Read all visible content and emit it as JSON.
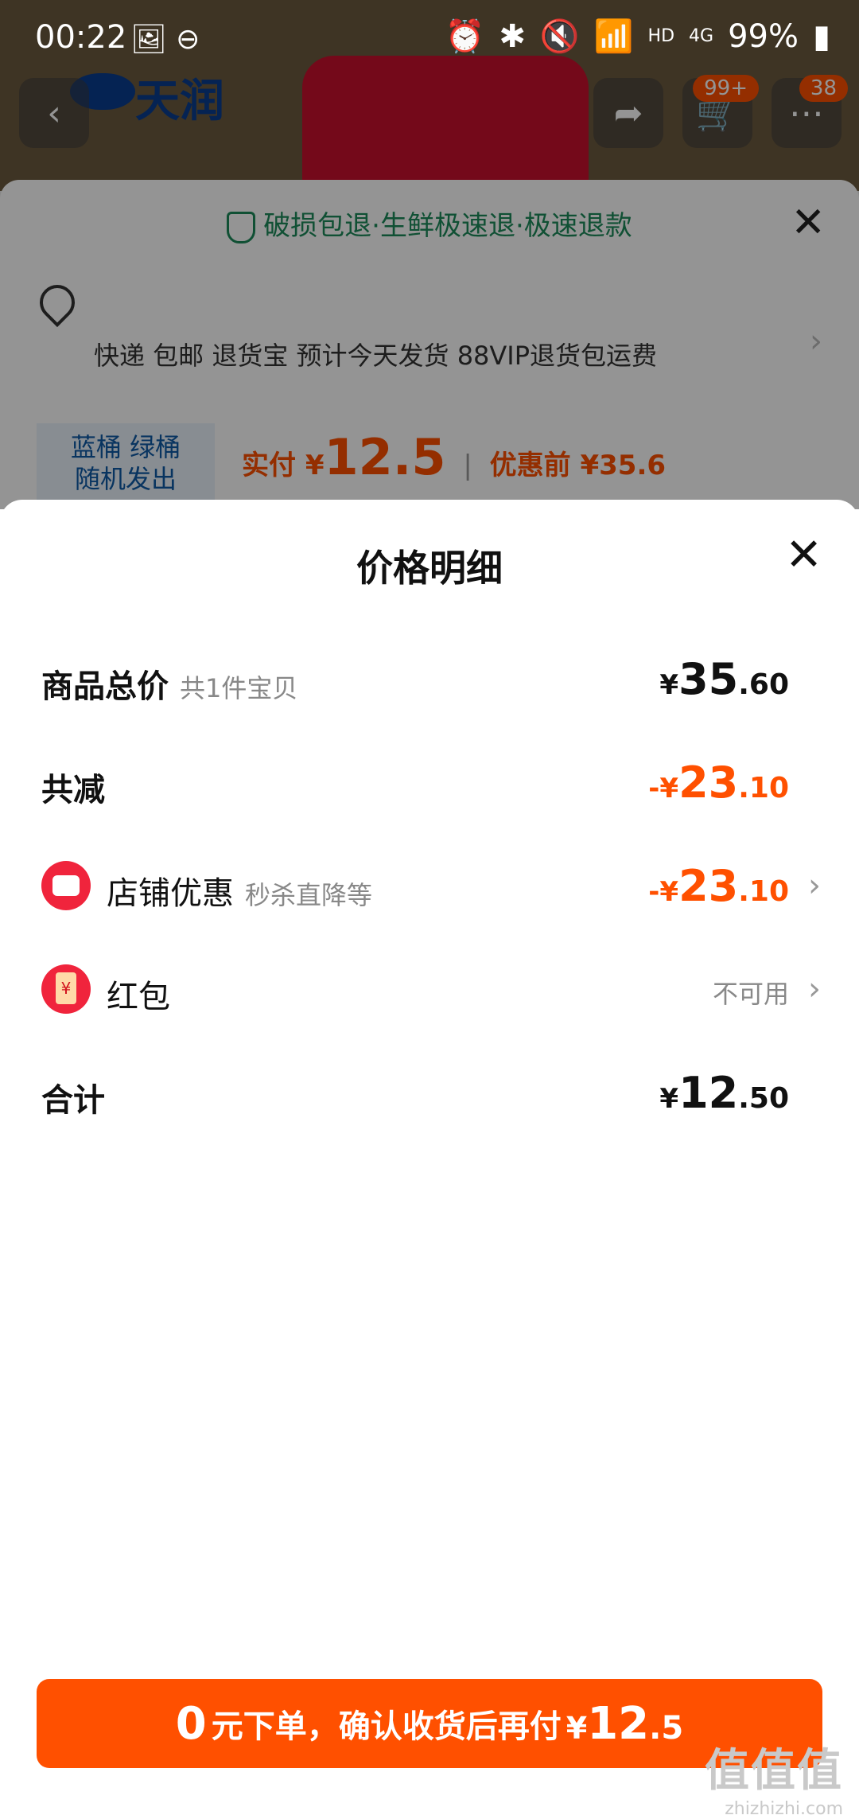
{
  "status_bar": {
    "time": "00:22",
    "battery": "99%",
    "network": "4G",
    "hd": "HD"
  },
  "background": {
    "brand": "天润",
    "cart_badge": "99+",
    "msg_badge": "38",
    "guarantee": "破损包退·生鲜极速退·极速退款",
    "shipping_line": "快递 包邮 退货宝 预计今天发货 88VIP退货包运费",
    "product_tag_line1": "蓝桶  绿桶",
    "product_tag_line2": "随机发出",
    "pay_label": "实付 ¥",
    "pay_amount": "12.5",
    "before_label": "优惠前 ¥35.6"
  },
  "sheet": {
    "title": "价格明细",
    "rows": {
      "total": {
        "label": "商品总价",
        "sub": "共1件宝贝",
        "cur": "¥",
        "int": "35",
        "dec": ".60"
      },
      "reduce": {
        "label": "共减",
        "cur": "-¥",
        "int": "23",
        "dec": ".10"
      },
      "shop": {
        "label": "店铺优惠",
        "sub": "秒杀直降等",
        "cur": "-¥",
        "int": "23",
        "dec": ".10"
      },
      "hongbao": {
        "label": "红包",
        "value": "不可用"
      },
      "sum": {
        "label": "合计",
        "cur": "¥",
        "int": "12",
        "dec": ".50"
      }
    },
    "cta": {
      "zero": "0",
      "mid": "元下单，确认收货后再付",
      "cur": "¥",
      "int": "12",
      "dec": ".5"
    }
  },
  "watermark": {
    "line1": "值值值",
    "line2": "zhizhizhi.com"
  },
  "colors": {
    "accent": "#ff5000",
    "green": "#1c8a5a"
  }
}
